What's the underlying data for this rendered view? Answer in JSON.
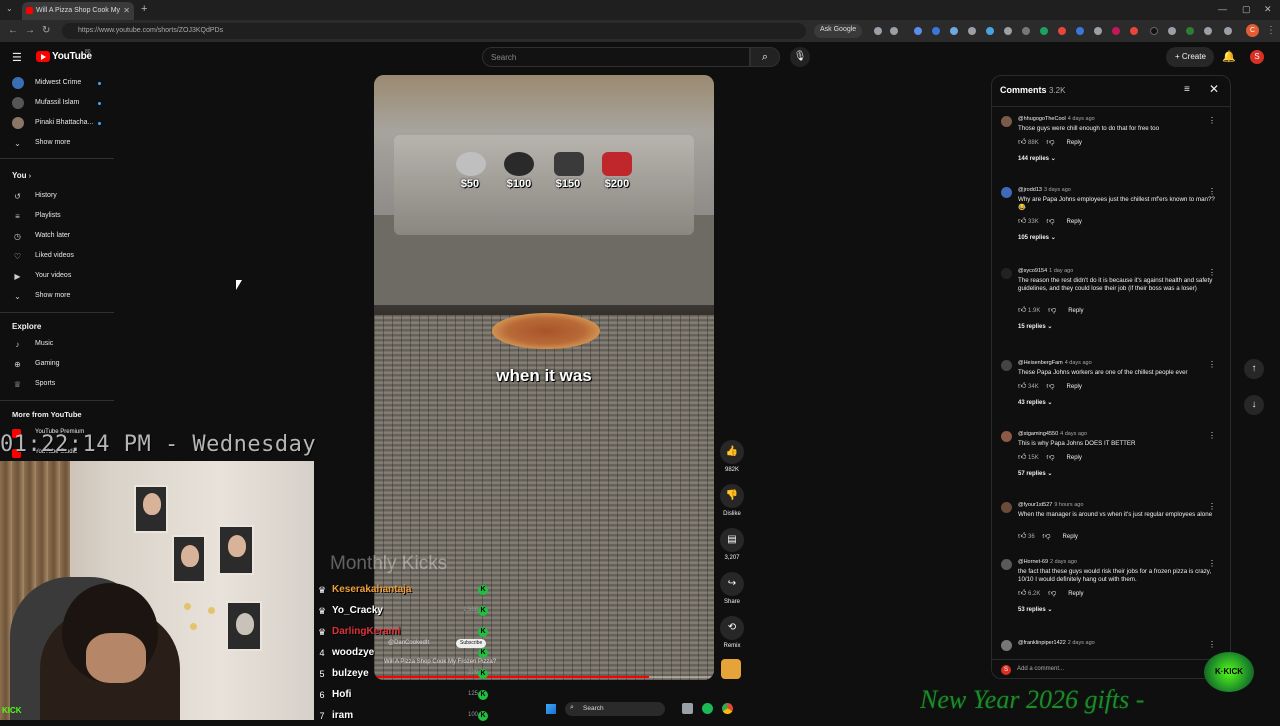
{
  "browser": {
    "tab_title": "Will A Pizza Shop Cook My",
    "url": "https://www.youtube.com/shorts/ZOJ3KQdPDs",
    "ask_google": "Ask Google",
    "profile_initial": "C"
  },
  "yt": {
    "logo_text": "YouTube",
    "country": "80",
    "search_placeholder": "Search",
    "create_label": "Create",
    "avatar_initial": "S"
  },
  "sidebar": {
    "subscriptions": [
      {
        "label": "Midwest Crime",
        "color": "#3a6fb5"
      },
      {
        "label": "Mufassil Islam",
        "color": "#555555"
      },
      {
        "label": "Pinaki Bhattacha...",
        "color": "#8a7766"
      }
    ],
    "show_more_1": "Show more",
    "you_heading": "You",
    "you_items": [
      {
        "label": "History",
        "icon": "history-icon",
        "glyph": "↺"
      },
      {
        "label": "Playlists",
        "icon": "playlists-icon",
        "glyph": "≡"
      },
      {
        "label": "Watch later",
        "icon": "watch-later-icon",
        "glyph": "◷"
      },
      {
        "label": "Liked videos",
        "icon": "liked-icon",
        "glyph": "👍"
      },
      {
        "label": "Your videos",
        "icon": "your-videos-icon",
        "glyph": "▶"
      }
    ],
    "show_more_2": "Show more",
    "explore_heading": "Explore",
    "explore_items": [
      {
        "label": "Music",
        "icon": "music-icon",
        "glyph": "♪"
      },
      {
        "label": "Gaming",
        "icon": "gaming-icon",
        "glyph": "⌘"
      },
      {
        "label": "Sports",
        "icon": "sports-icon",
        "glyph": "🏆"
      }
    ],
    "more_heading": "More from YouTube",
    "more_items": [
      {
        "label": "YouTube Premium"
      },
      {
        "label": "YouTube Studio"
      }
    ]
  },
  "overlay": {
    "clock": "01:22:14 PM - Wednesday",
    "leaderboard_title": "Monthly Kicks",
    "leaderboard": [
      {
        "rank": "♛",
        "name": "Keserakahantaja",
        "amount": "",
        "name_color": "#f0a03a"
      },
      {
        "rank": "♛",
        "name": "Yo_Cracky",
        "amount": "1,568",
        "name_color": "#ffffff"
      },
      {
        "rank": "♛",
        "name": "DarlingKerami",
        "amount": "",
        "name_color": "#e0303a"
      },
      {
        "rank": "4",
        "name": "woodzye",
        "amount": "",
        "name_color": "#ffffff"
      },
      {
        "rank": "5",
        "name": "bulzeye",
        "amount": "229",
        "name_color": "#ffffff"
      },
      {
        "rank": "6",
        "name": "Hofi",
        "amount": "125",
        "name_color": "#ffffff"
      },
      {
        "rank": "7",
        "name": "iram",
        "amount": "100",
        "name_color": "#ffffff"
      }
    ],
    "banner": "New Year 2026 gifts -",
    "kick_badge": "K·KICK",
    "kick_logo": "KICK"
  },
  "video": {
    "prices": [
      "$50",
      "$100",
      "$150",
      "$200"
    ],
    "caption": "when it was",
    "channel": "@DanCookedIt",
    "subscribe_label": "Subscribe",
    "title": "Will A Pizza Shop Cook My Frozen Pizza?",
    "progress": 0.81
  },
  "actions": {
    "like_count": "982K",
    "dislike_label": "Dislike",
    "comments_count": "3,207",
    "share_label": "Share",
    "remix_label": "Remix"
  },
  "comments": {
    "title": "Comments",
    "count": "3.2K",
    "add_placeholder": "Add a comment...",
    "items": [
      {
        "user": "@hhugogoTheCool",
        "ago": "4 days ago",
        "text": "Those guys were chill enough to do that for free too",
        "likes": "88K",
        "replies": "144 replies",
        "avatar": "#7a5b4a"
      },
      {
        "user": "@jrodd13",
        "ago": "3 days ago",
        "text": "Why are Papa Johns employees just the chillest mf'ers known to man?? 😂",
        "likes": "33K",
        "replies": "105 replies",
        "avatar": "#3e6ab8"
      },
      {
        "user": "@syco9154",
        "ago": "1 day ago",
        "text": "The reason the rest didn't do it is because it's against health and safety guidelines, and they could lose their job (if their boss was a loser)",
        "likes": "1.9K",
        "replies": "15 replies",
        "avatar": "#222222"
      },
      {
        "user": "@HeisenbergFam",
        "ago": "4 days ago",
        "text": "These Papa Johns workers are one of the chillest people ever",
        "likes": "34K",
        "replies": "43 replies",
        "avatar": "#444444"
      },
      {
        "user": "@stgaming4550",
        "ago": "4 days ago",
        "text": "This is why Papa Johns DOES IT BETTER",
        "likes": "15K",
        "replies": "57 replies",
        "avatar": "#8a5a44"
      },
      {
        "user": "@fyour1st527",
        "ago": "9 hours ago",
        "text": "When the manager is around vs when it's just regular employees alone",
        "likes": "36",
        "replies": "",
        "avatar": "#6b4a3a"
      },
      {
        "user": "@Hornet-69",
        "ago": "2 days ago",
        "text": "the fact that these guys would risk their jobs for a frozen pizza is crazy, 10/10 I would definitely hang out with them.",
        "likes": "6.2K",
        "replies": "53 replies",
        "avatar": "#5a5a5a"
      },
      {
        "user": "@franklinpiper1422",
        "ago": "2 days ago",
        "text": "",
        "likes": "",
        "replies": "",
        "avatar": "#777777"
      }
    ],
    "reply_label": "Reply"
  },
  "taskbar": {
    "search_label": "Search"
  }
}
